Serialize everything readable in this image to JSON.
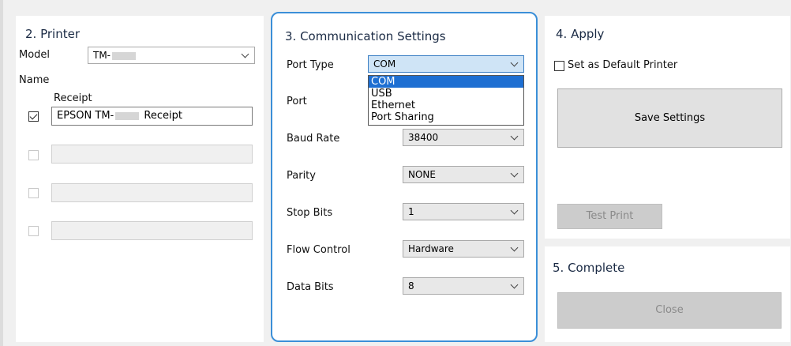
{
  "printer": {
    "heading": "2. Printer",
    "model_label": "Model",
    "model_value": "TM-",
    "name_label": "Name",
    "receipt_label": "Receipt",
    "receipt_prefix": "EPSON TM-",
    "receipt_suffix": "Receipt",
    "rows": [
      {
        "checked": true,
        "enabled": true
      },
      {
        "checked": false,
        "enabled": false
      },
      {
        "checked": false,
        "enabled": false
      },
      {
        "checked": false,
        "enabled": false
      }
    ]
  },
  "communication": {
    "heading": "3. Communication Settings",
    "port_type_label": "Port Type",
    "port_type_value": "COM",
    "port_type_options": [
      "COM",
      "USB",
      "Ethernet",
      "Port Sharing"
    ],
    "port_label": "Port",
    "baud_rate_label": "Baud Rate",
    "baud_rate_value": "38400",
    "parity_label": "Parity",
    "parity_value": "NONE",
    "stop_bits_label": "Stop Bits",
    "stop_bits_value": "1",
    "flow_control_label": "Flow Control",
    "flow_control_value": "Hardware",
    "data_bits_label": "Data Bits",
    "data_bits_value": "8"
  },
  "apply": {
    "heading": "4. Apply",
    "default_printer_label": "Set as Default Printer",
    "save_button": "Save Settings",
    "test_print_button": "Test Print"
  },
  "complete": {
    "heading": "5. Complete",
    "close_button": "Close"
  },
  "colors": {
    "accent": "#3b8fd8",
    "selection": "#1e6fd2"
  }
}
